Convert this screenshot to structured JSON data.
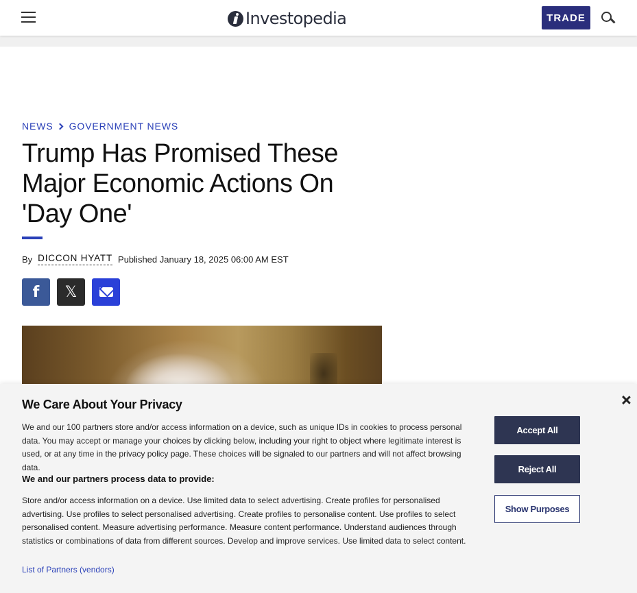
{
  "header": {
    "logo_text": "Investopedia",
    "trade_label": "TRADE"
  },
  "breadcrumb": {
    "items": [
      "NEWS",
      "GOVERNMENT NEWS"
    ]
  },
  "article": {
    "title": "Trump Has Promised These Major Economic Actions On 'Day One'",
    "by_label": "By",
    "author": "DICCON HYATT",
    "published": "Published January 18, 2025 06:00 AM EST"
  },
  "share": {
    "facebook_glyph": "f",
    "x_glyph": "𝕏"
  },
  "consent": {
    "title": "We Care About Your Privacy",
    "body": "We and our 100 partners store and/or access information on a device, such as unique IDs in cookies to process personal data. You may accept or manage your choices by clicking below, including your right to object where legitimate interest is used, or at any time in the privacy policy page. These choices will be signaled to our partners and will not affect browsing data.",
    "subheading": "We and our partners process data to provide:",
    "purposes": "Store and/or access information on a device. Use limited data to select advertising. Create profiles for personalised advertising. Use profiles to select personalised advertising. Create profiles to personalise content. Use profiles to select personalised content. Measure advertising performance. Measure content performance. Understand audiences through statistics or combinations of data from different sources. Develop and improve services. Use limited data to select content.",
    "partners_link": "List of Partners (vendors)",
    "accept_label": "Accept All",
    "reject_label": "Reject All",
    "purposes_label": "Show Purposes"
  },
  "colors": {
    "brand_navy": "#2a2e7c",
    "link_blue": "#2a40b8",
    "consent_button": "#2e3552"
  }
}
